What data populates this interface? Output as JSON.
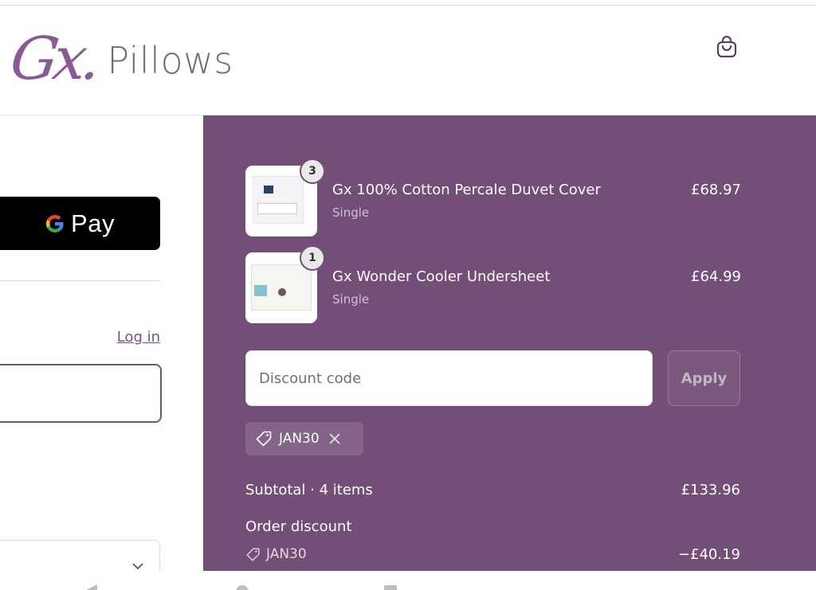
{
  "header": {
    "logo_mark": "Gx.",
    "logo_text": "Pillows",
    "cart_icon": "shopping-bag-icon"
  },
  "express_checkout": {
    "gpay_label": "Pay"
  },
  "account": {
    "login_label": "Log in",
    "email_value": ""
  },
  "order": {
    "items": [
      {
        "quantity": "3",
        "name": "Gx 100% Cotton Percale Duvet Cover",
        "variant": "Single",
        "price": "£68.97"
      },
      {
        "quantity": "1",
        "name": "Gx Wonder Cooler Undersheet",
        "variant": "Single",
        "price": "£64.99"
      }
    ],
    "discount": {
      "placeholder": "Discount code",
      "apply_label": "Apply",
      "applied_code": "JAN30"
    },
    "summary": {
      "subtotal_label": "Subtotal · 4 items",
      "subtotal_value": "£133.96",
      "order_discount_label": "Order discount",
      "order_discount_code": "JAN30",
      "order_discount_value": "−£40.19"
    }
  },
  "colors": {
    "brand": "#734f78",
    "accent": "#7a4f86"
  }
}
